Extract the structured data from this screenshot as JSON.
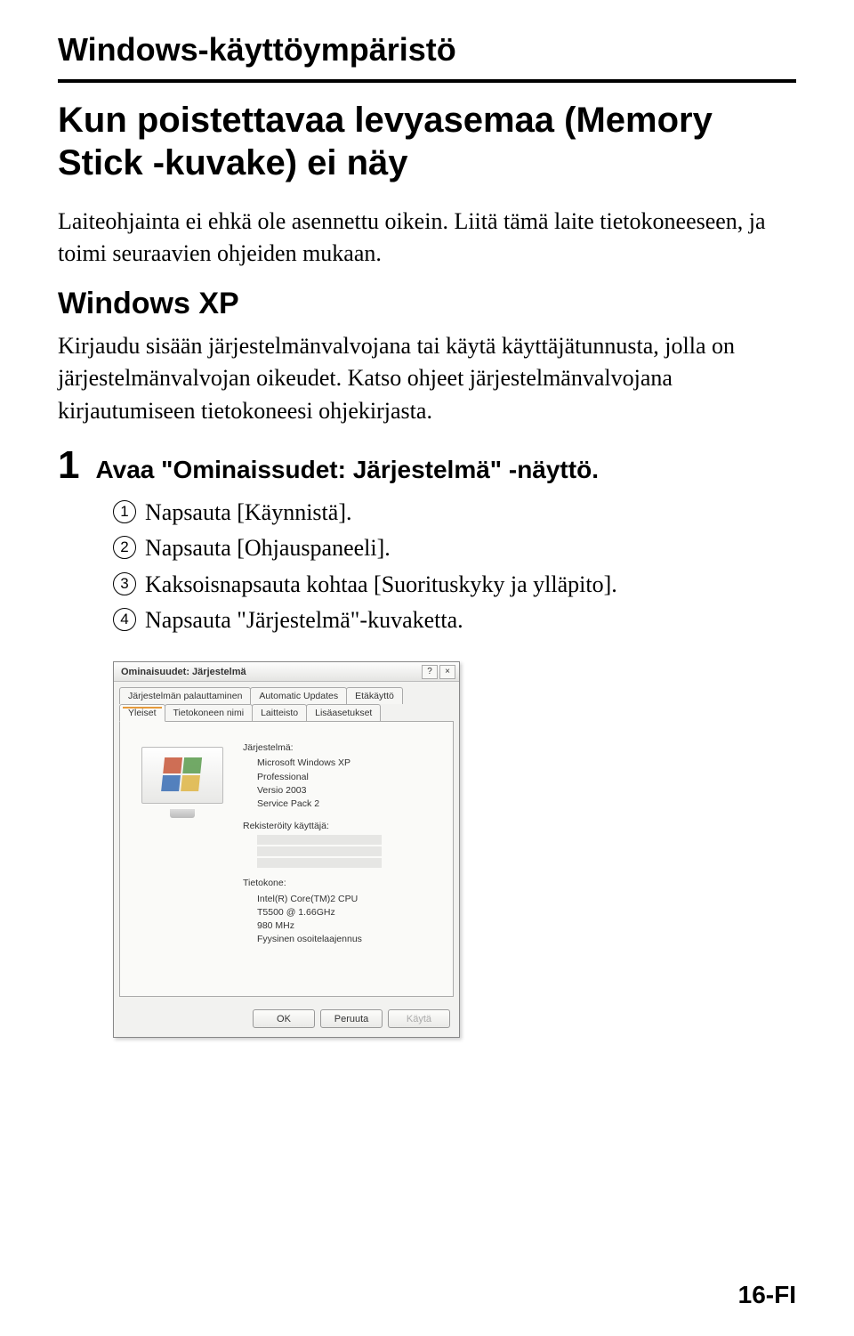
{
  "section_heading": "Windows-käyttöympäristö",
  "title": "Kun poistettavaa levyasemaa (Memory Stick -kuvake) ei näy",
  "para1": "Laiteohjainta ei ehkä ole asennettu oikein. Liitä tämä laite tietokoneeseen, ja toimi seuraavien ohjeiden mukaan.",
  "sub_heading": "Windows XP",
  "para2": "Kirjaudu sisään järjestelmänvalvojana tai käytä käyttäjätunnusta, jolla on järjestelmänvalvojan oikeudet. Katso ohjeet järjestelmänvalvojana kirjautumiseen tietokoneesi ohjekirjasta.",
  "step": {
    "num": "1",
    "text": "Avaa \"Ominaissudet: Järjestelmä\" -näyttö.",
    "items": [
      "Napsauta [Käynnistä].",
      "Napsauta [Ohjauspaneeli].",
      "Kaksoisnapsauta kohtaa [Suorituskyky ja ylläpito].",
      "Napsauta \"Järjestelmä\"-kuvaketta."
    ]
  },
  "dialog": {
    "title": "Ominaisuudet: Järjestelmä",
    "help": "?",
    "close": "×",
    "tabs_row1": [
      "Järjestelmän palauttaminen",
      "Automatic Updates",
      "Etäkäyttö"
    ],
    "tabs_row2": [
      "Yleiset",
      "Tietokoneen nimi",
      "Laitteisto",
      "Lisäasetukset"
    ],
    "active_tab": "Yleiset",
    "sys_label": "Järjestelmä:",
    "sys_lines": [
      "Microsoft Windows XP",
      "Professional",
      "Versio 2003",
      "Service Pack 2"
    ],
    "reg_label": "Rekisteröity käyttäjä:",
    "comp_label": "Tietokone:",
    "comp_lines": [
      "Intel(R) Core(TM)2 CPU",
      "T5500 @ 1.66GHz",
      "980 MHz",
      "Fyysinen osoitelaajennus"
    ],
    "buttons": {
      "ok": "OK",
      "cancel": "Peruuta",
      "apply": "Käytä"
    }
  },
  "footer": "16-FI"
}
